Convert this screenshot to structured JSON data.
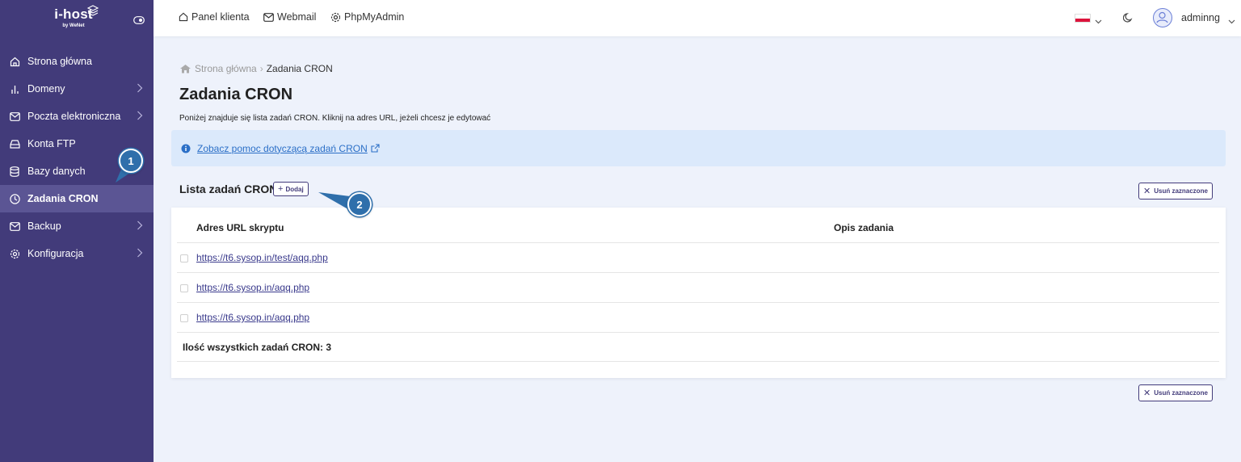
{
  "logo": {
    "brand": "i-host",
    "by": "by WeNet"
  },
  "sidebar": {
    "items": [
      {
        "label": "Strona główna",
        "icon": "home-icon",
        "has_chevron": false,
        "active": false
      },
      {
        "label": "Domeny",
        "icon": "bar-chart-icon",
        "has_chevron": true,
        "active": false
      },
      {
        "label": "Poczta elektroniczna",
        "icon": "mail-icon",
        "has_chevron": true,
        "active": false
      },
      {
        "label": "Konta FTP",
        "icon": "drive-icon",
        "has_chevron": false,
        "active": false
      },
      {
        "label": "Bazy danych",
        "icon": "database-icon",
        "has_chevron": false,
        "active": false
      },
      {
        "label": "Zadania CRON",
        "icon": "clock-icon",
        "has_chevron": false,
        "active": true
      },
      {
        "label": "Backup",
        "icon": "mail-icon",
        "has_chevron": true,
        "active": false
      },
      {
        "label": "Konfiguracja",
        "icon": "gear-icon",
        "has_chevron": true,
        "active": false
      }
    ]
  },
  "topbar": {
    "panel_label": "Panel klienta",
    "webmail_label": "Webmail",
    "pma_label": "PhpMyAdmin",
    "username": "adminng"
  },
  "breadcrumb": {
    "home": "Strona główna",
    "current": "Zadania CRON"
  },
  "page": {
    "title": "Zadania CRON",
    "description": "Poniżej znajduje się lista zadań CRON. Kliknij na adres URL, jeżeli chcesz je edytować",
    "help_link": "Zobacz pomoc dotyczącą zadań CRON"
  },
  "list": {
    "title": "Lista zadań CRON",
    "add_label": "Dodaj",
    "delete_label": "Usuń zaznaczone",
    "columns": [
      "Adres URL skryptu",
      "Opis zadania"
    ],
    "rows": [
      {
        "url": "https://t6.sysop.in/test/aqq.php",
        "description": ""
      },
      {
        "url": "https://t6.sysop.in/aqq.php",
        "description": ""
      },
      {
        "url": "https://t6.sysop.in/aqq.php",
        "description": ""
      }
    ],
    "total_text": "Ilość wszystkich zadań CRON: 3"
  },
  "markers": [
    "1",
    "2"
  ],
  "colors": {
    "sidebar_bg": "#423b7a",
    "sidebar_active": "#5b5594",
    "marker": "#2f6fab",
    "info_bg": "#dbe9fb"
  }
}
